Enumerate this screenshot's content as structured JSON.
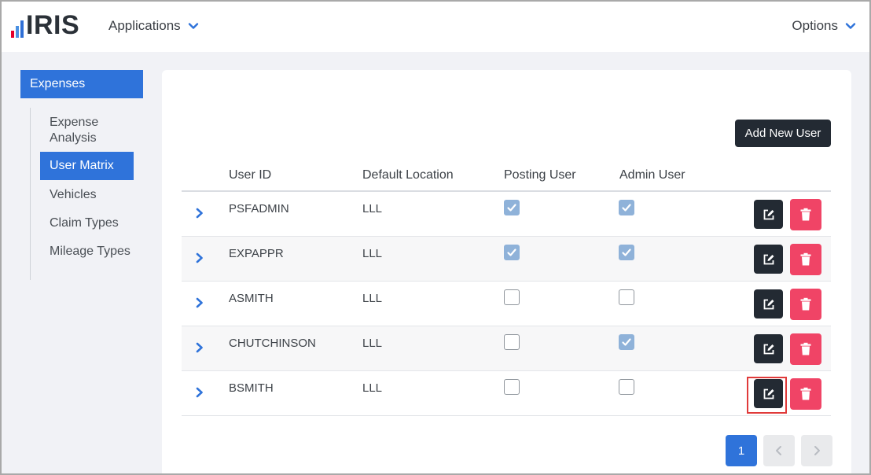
{
  "app": {
    "logo_text": "IRIS"
  },
  "topnav": {
    "applications_label": "Applications",
    "options_label": "Options"
  },
  "sidebar": {
    "header": "Expenses",
    "items": [
      {
        "label": "Expense Analysis",
        "active": false
      },
      {
        "label": "User Matrix",
        "active": true
      },
      {
        "label": "Vehicles",
        "active": false
      },
      {
        "label": "Claim Types",
        "active": false
      },
      {
        "label": "Mileage Types",
        "active": false
      }
    ]
  },
  "toolbar": {
    "add_user_label": "Add New User"
  },
  "table": {
    "columns": [
      "User ID",
      "Default Location",
      "Posting User",
      "Admin User"
    ],
    "rows": [
      {
        "user_id": "PSFADMIN",
        "location": "LLL",
        "posting": true,
        "admin": true
      },
      {
        "user_id": "EXPAPPR",
        "location": "LLL",
        "posting": true,
        "admin": true
      },
      {
        "user_id": "ASMITH",
        "location": "LLL",
        "posting": false,
        "admin": false
      },
      {
        "user_id": "CHUTCHINSON",
        "location": "LLL",
        "posting": false,
        "admin": true
      },
      {
        "user_id": "BSMITH",
        "location": "LLL",
        "posting": false,
        "admin": false
      }
    ]
  },
  "pagination": {
    "current_page": "1"
  },
  "colors": {
    "accent": "#2f73da",
    "dark": "#232a33",
    "danger": "#f04466",
    "checked": "#8fb2d9",
    "highlight": "#e03a3a"
  },
  "icons": [
    "chevron-down-icon",
    "chevron-right-icon",
    "edit-icon",
    "trash-icon",
    "check-icon",
    "chevron-left-icon"
  ]
}
